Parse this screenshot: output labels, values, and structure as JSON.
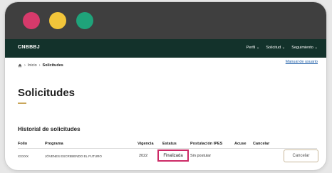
{
  "window_controls": {
    "close_color": "#d63a6b",
    "minimize_color": "#f2c53a",
    "maximize_color": "#1fa37a"
  },
  "navbar": {
    "brand": "CNBBBJ",
    "menu": [
      "Perfil ⌄",
      "Solicitud ⌄",
      "Seguimiento ⌄"
    ],
    "background": "#13322b"
  },
  "breadcrumb": {
    "home_sep": "›",
    "inicio": "Inicio",
    "sep": "›",
    "current": "Solicitudes"
  },
  "manual_link": "Manual de usuario",
  "page_title": "Solicitudes",
  "section_title": "Historial de solicitudes",
  "table": {
    "headers": [
      "Folio",
      "Programa",
      "Vigencia",
      "Estatus",
      "Postulación IPES",
      "Acuse",
      "Cancelar"
    ],
    "row": {
      "folio": "XXXXX",
      "programa": "JÓVENES ESCRIBIENDO EL FUTURO",
      "vigencia": "2022",
      "estatus": "Finalizada",
      "postulacion": "Sin postular",
      "cancel_label": "Cancelar"
    }
  }
}
